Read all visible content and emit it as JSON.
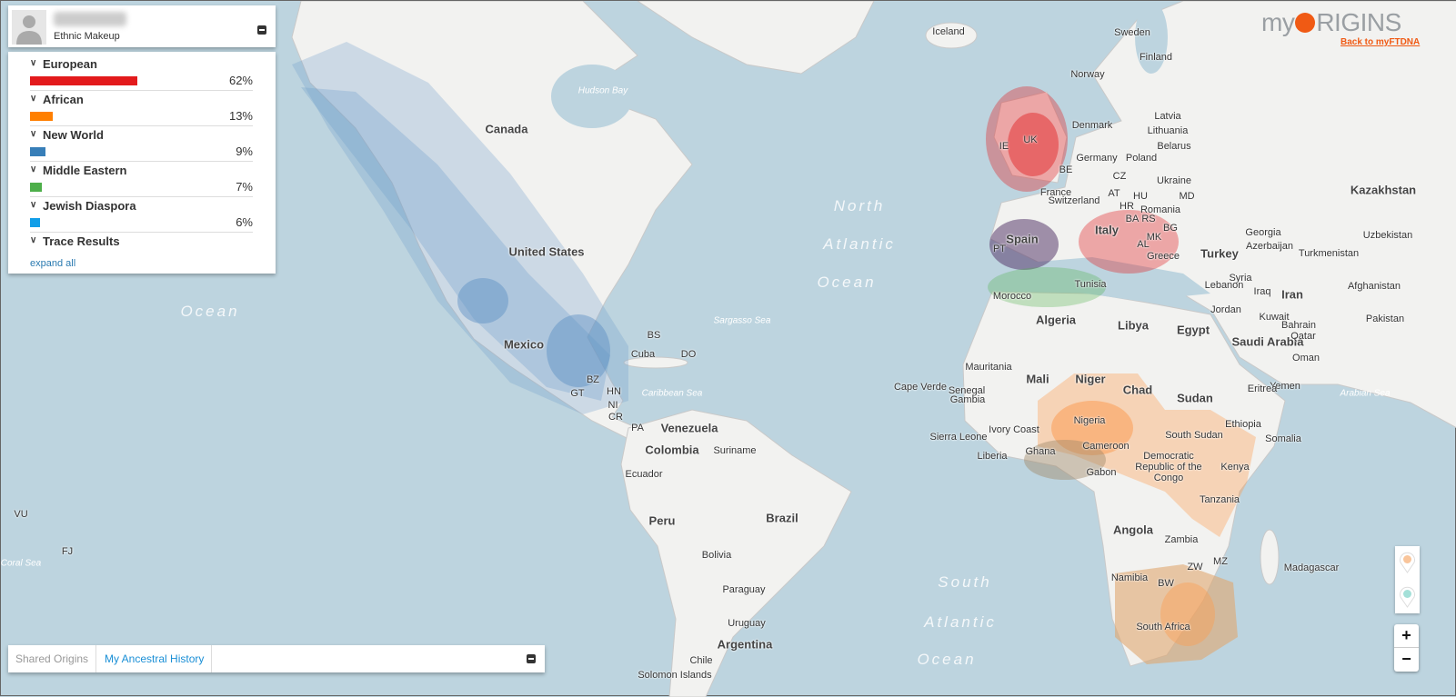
{
  "panel": {
    "subtitle": "Ethnic Makeup",
    "categories": [
      {
        "label": "European",
        "percent": 62,
        "percent_text": "62%",
        "color": "#e31a1c"
      },
      {
        "label": "African",
        "percent": 13,
        "percent_text": "13%",
        "color": "#ff7f00"
      },
      {
        "label": "New World",
        "percent": 9,
        "percent_text": "9%",
        "color": "#377eb8"
      },
      {
        "label": "Middle Eastern",
        "percent": 7,
        "percent_text": "7%",
        "color": "#4daf4a"
      },
      {
        "label": "Jewish Diaspora",
        "percent": 6,
        "percent_text": "6%",
        "color": "#119ee8"
      },
      {
        "label": "Trace Results"
      }
    ],
    "expand_all": "expand all"
  },
  "logo": {
    "text_left": "my",
    "text_right": "RIGINS",
    "back_link": "Back to myFTDNA"
  },
  "tabs": [
    "Shared Origins",
    "My Ancestral History"
  ],
  "zoom": {
    "in": "+",
    "out": "−"
  },
  "marker_colors": [
    "#f9c59b",
    "#a4e0d8"
  ],
  "map_labels": [
    "Iceland",
    "Sweden",
    "Finland",
    "Norway",
    "Latvia",
    "Lithuania",
    "Denmark",
    "Belarus",
    "Germany",
    "Poland",
    "Ukraine",
    "France",
    "Switzerland",
    "CZ",
    "AT",
    "HU",
    "MD",
    "HR",
    "Romania",
    "BA",
    "RS",
    "BG",
    "MK",
    "AL",
    "Italy",
    "Greece",
    "Turkey",
    "Spain",
    "PT",
    "Morocco",
    "Tunisia",
    "Algeria",
    "Libya",
    "Egypt",
    "UK",
    "IE",
    "BE",
    "Kazakhstan",
    "Uzbekistan",
    "Georgia",
    "Azerbaijan",
    "Turkmenistan",
    "Syria",
    "Lebanon",
    "Iraq",
    "Iran",
    "Afghanistan",
    "Jordan",
    "Kuwait",
    "Pakistan",
    "Saudi Arabia",
    "Bahrain",
    "Qatar",
    "Oman",
    "Yemen",
    "Eritrea",
    "Sudan",
    "Ethiopia",
    "Somalia",
    "Chad",
    "Niger",
    "Mali",
    "Mauritania",
    "Nigeria",
    "Cameroon",
    "Ghana",
    "Gabon",
    "Liberia",
    "Sierra Leone",
    "Ivory Coast",
    "Senegal",
    "Gambia",
    "Cape Verde",
    "South Sudan",
    "Kenya",
    "Democratic Republic of the Congo",
    "Tanzania",
    "Angola",
    "Zambia",
    "MZ",
    "ZW",
    "BW",
    "Namibia",
    "South Africa",
    "Madagascar",
    "Canada",
    "United States",
    "Mexico",
    "BS",
    "Cuba",
    "DO",
    "BZ",
    "GT",
    "HN",
    "NI",
    "CR",
    "PA",
    "Venezuela",
    "Colombia",
    "Suriname",
    "Ecuador",
    "Peru",
    "Brazil",
    "Bolivia",
    "Paraguay",
    "Uruguay",
    "Argentina",
    "Chile",
    "Solomon Islands",
    "VU",
    "FJ"
  ],
  "sea_labels": [
    "North",
    "Atlantic",
    "Ocean",
    "Ocean",
    "South",
    "Atlantic",
    "Ocean",
    "South"
  ],
  "small_sea_labels": [
    "Hudson Bay",
    "Sargasso Sea",
    "Caribbean Sea",
    "Arabian Sea",
    "Coral Sea"
  ]
}
